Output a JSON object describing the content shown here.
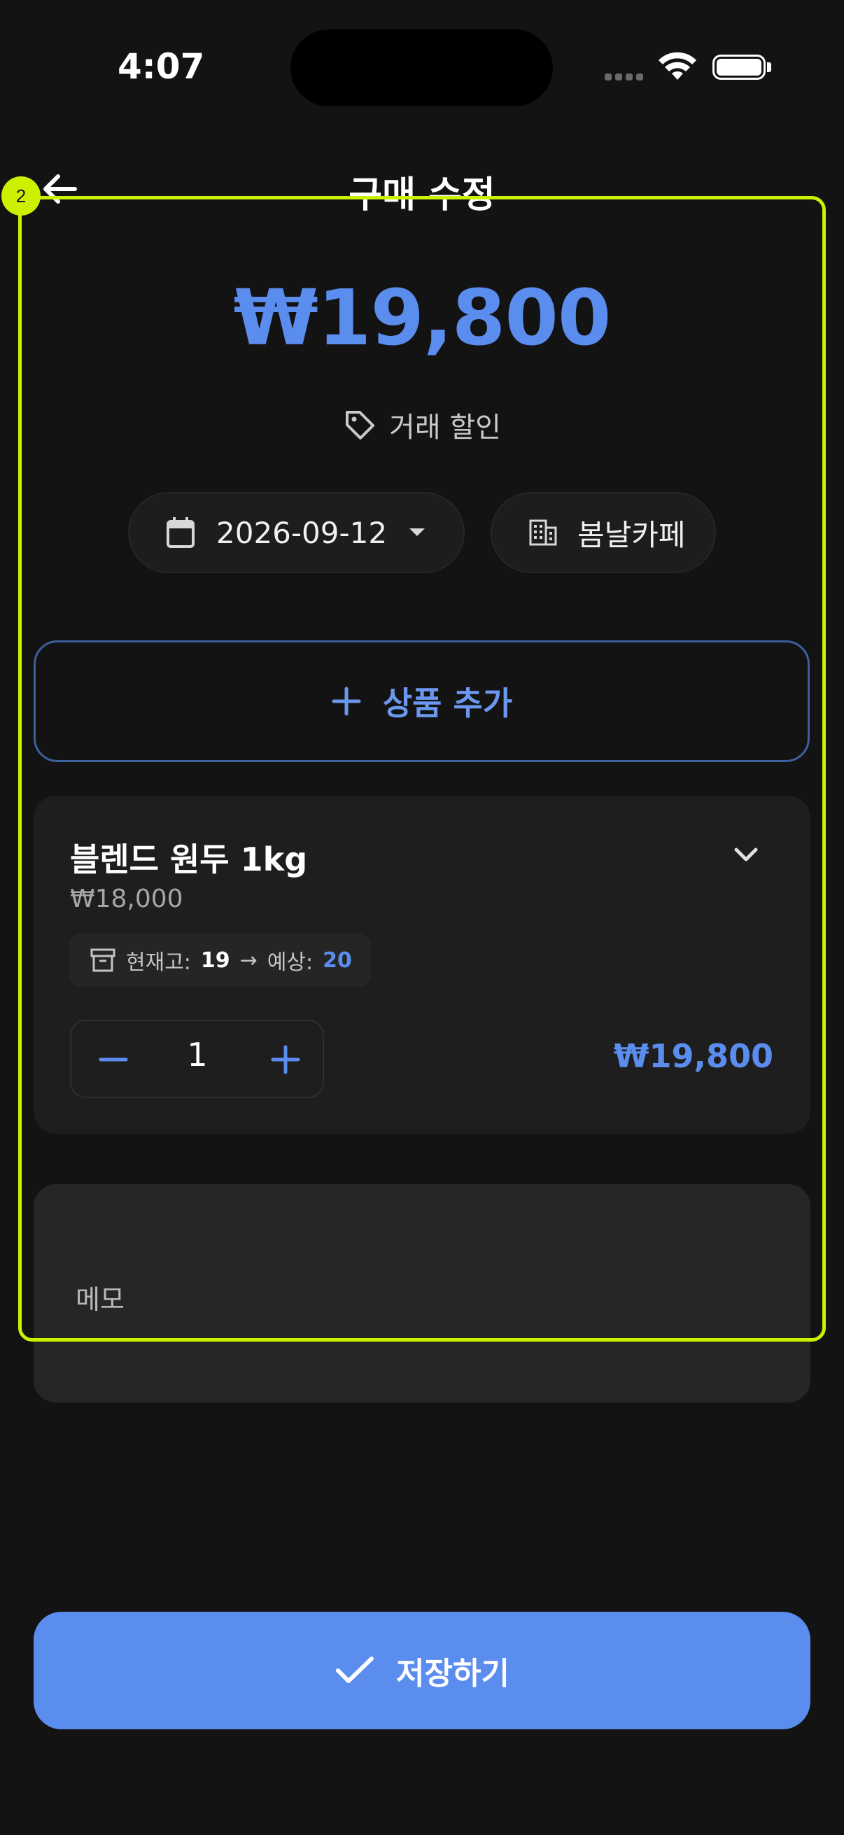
{
  "status_bar": {
    "time": "4:07"
  },
  "header": {
    "title": "구매 수정"
  },
  "summary": {
    "total": "₩19,800",
    "discount_label": "거래 할인"
  },
  "chips": {
    "date": "2026-09-12",
    "store": "봄날카페"
  },
  "add_product": {
    "label": "상품 추가"
  },
  "product": {
    "name": "블렌드 원두 1kg",
    "unit_price": "₩18,000",
    "stock_label": "현재고:",
    "stock_current": "19",
    "stock_arrow": "→",
    "expected_label": "예상:",
    "stock_expected": "20",
    "quantity": "1",
    "line_total": "₩19,800"
  },
  "memo": {
    "placeholder": "메모"
  },
  "save": {
    "label": "저장하기"
  },
  "overlay": {
    "badge": "2"
  },
  "colors": {
    "accent": "#5b8def",
    "background": "#131313",
    "card": "#1e1e1e",
    "highlight": "#cdf000"
  }
}
